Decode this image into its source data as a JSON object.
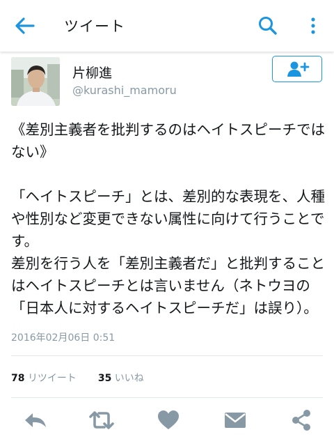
{
  "header": {
    "title": "ツイート"
  },
  "author": {
    "display_name": "片柳進",
    "handle": "@kurashi_mamoru"
  },
  "tweet": {
    "text": "《差別主義者を批判するのはヘイトスピーチではない》\n\n「ヘイトスピーチ」とは、差別的な表現を、人種や性別など変更できない属性に向けて行うことです。\n差別を行う人を「差別主義者だ」と批判することはヘイトスピーチとは言いません（ネトウヨの「日本人に対するヘイトスピーチだ」は誤り）。",
    "timestamp": "2016年02月06日 0:51"
  },
  "stats": {
    "retweet_count": "78",
    "retweet_label": "リツイート",
    "like_count": "35",
    "like_label": "いいね"
  },
  "icons": {
    "back": "back-arrow-icon",
    "search": "search-icon",
    "more": "more-vertical-icon",
    "follow": "follow-user-icon",
    "reply": "reply-icon",
    "retweet": "retweet-icon",
    "like": "heart-icon",
    "dm": "envelope-icon",
    "share": "share-icon"
  },
  "colors": {
    "accent": "#1b95e0",
    "icon_gray": "#8899a6",
    "text": "#14171a"
  }
}
